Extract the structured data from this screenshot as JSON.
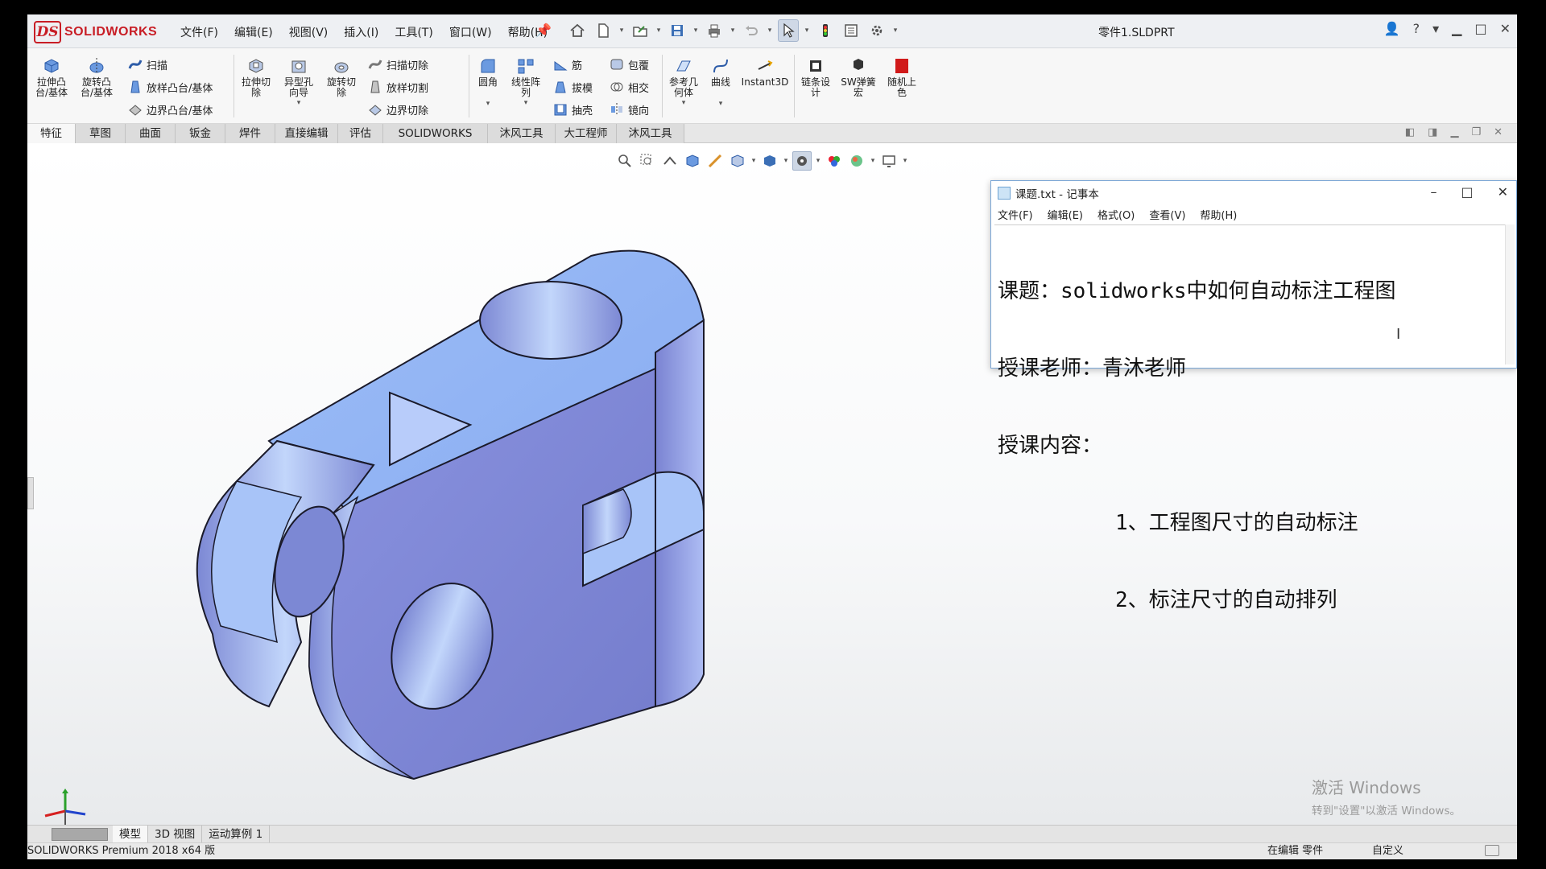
{
  "app": {
    "logo_text": "SOLIDWORKS",
    "doc_title": "零件1.SLDPRT",
    "menu": [
      "文件(F)",
      "编辑(E)",
      "视图(V)",
      "插入(I)",
      "工具(T)",
      "窗口(W)",
      "帮助(H)"
    ]
  },
  "ribbon": {
    "extrude_boss": "拉伸凸\n台/基体",
    "revolve_boss": "旋转凸\n台/基体",
    "sweep": "扫描",
    "loft_boss": "放样凸台/基体",
    "boundary_boss": "边界凸台/基体",
    "extrude_cut": "拉伸切\n除",
    "hole_wizard": "异型孔\n向导",
    "revolve_cut": "旋转切\n除",
    "sweep_cut": "扫描切除",
    "loft_cut": "放样切割",
    "boundary_cut": "边界切除",
    "fillet": "圆角",
    "linear_pattern": "线性阵\n列",
    "rib": "筋",
    "draft": "拔模",
    "shell": "抽壳",
    "wrap": "包覆",
    "intersect": "相交",
    "mirror": "镜向",
    "ref_geometry": "参考几\n何体",
    "curves": "曲线",
    "instant3d": "Instant3D",
    "chain_design": "链条设\n计",
    "sw_spring": "SW弹簧\n宏",
    "random_color": "随机上\n色"
  },
  "tabs": [
    "特征",
    "草图",
    "曲面",
    "钣金",
    "焊件",
    "直接编辑",
    "评估",
    "SOLIDWORKS 插件",
    "沐风工具箱",
    "大工程师",
    "沐风工具箱"
  ],
  "notepad": {
    "title": "课题.txt - 记事本",
    "menu": [
      "文件(F)",
      "编辑(E)",
      "格式(O)",
      "查看(V)",
      "帮助(H)"
    ],
    "lines": [
      "课题：solidworks中如何自动标注工程图",
      "授课老师：青沐老师",
      "授课内容：",
      "1、工程图尺寸的自动标注",
      "2、标注尺寸的自动排列"
    ]
  },
  "bottom_tabs": [
    "模型",
    "3D 视图",
    "运动算例 1"
  ],
  "status": {
    "left": "SOLIDWORKS Premium 2018 x64 版",
    "mode": "在编辑 零件",
    "custom": "自定义"
  },
  "watermark": {
    "title": "激活 Windows",
    "subtitle": "转到\"设置\"以激活 Windows。"
  },
  "colors": {
    "brand_red": "#c81d25",
    "part_face_top": "#8fb3f5",
    "part_face_front": "#7d86d8",
    "part_face_light": "#a8c4f8"
  }
}
